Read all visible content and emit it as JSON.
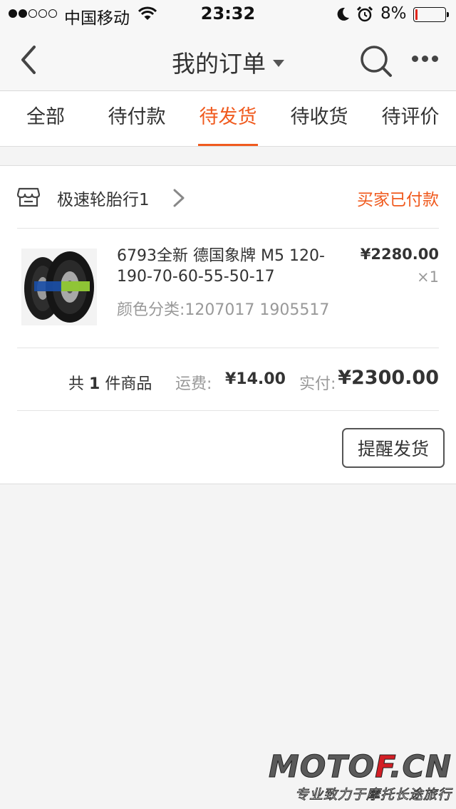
{
  "status_bar": {
    "carrier": "中国移动",
    "time": "23:32",
    "battery": "8%",
    "battery_level": 0.08
  },
  "nav": {
    "title": "我的订单",
    "icons": [
      "back-icon",
      "dropdown-caret-icon",
      "search-icon",
      "more-icon"
    ]
  },
  "tabs": [
    {
      "label": "全部"
    },
    {
      "label": "待付款"
    },
    {
      "label": "待发货",
      "active": true
    },
    {
      "label": "待收货"
    },
    {
      "label": "待评价"
    }
  ],
  "order": {
    "shop_name": "极速轮胎行1",
    "status": "买家已付款",
    "item": {
      "title": "6793全新 德国象牌 M5 120-190-70-60-55-50-17",
      "sku": "颜色分类:1207017 1905517",
      "price": "¥2280.00",
      "quantity": "×1"
    },
    "summary": {
      "count_prefix": "共",
      "count": "1",
      "count_suffix": "件商品",
      "freight_label": "运费:",
      "freight": "¥14.00",
      "paid_label": "实付:",
      "paid": "¥2300.00"
    },
    "action_label": "提醒发货"
  },
  "watermark": {
    "logo_main": "MOTO",
    "logo_accent": "F",
    "logo_tail": ".CN",
    "tagline": "专业致力于摩托长途旅行"
  },
  "colors": {
    "accent": "#f05a1e",
    "battery_low": "#e0261c"
  }
}
